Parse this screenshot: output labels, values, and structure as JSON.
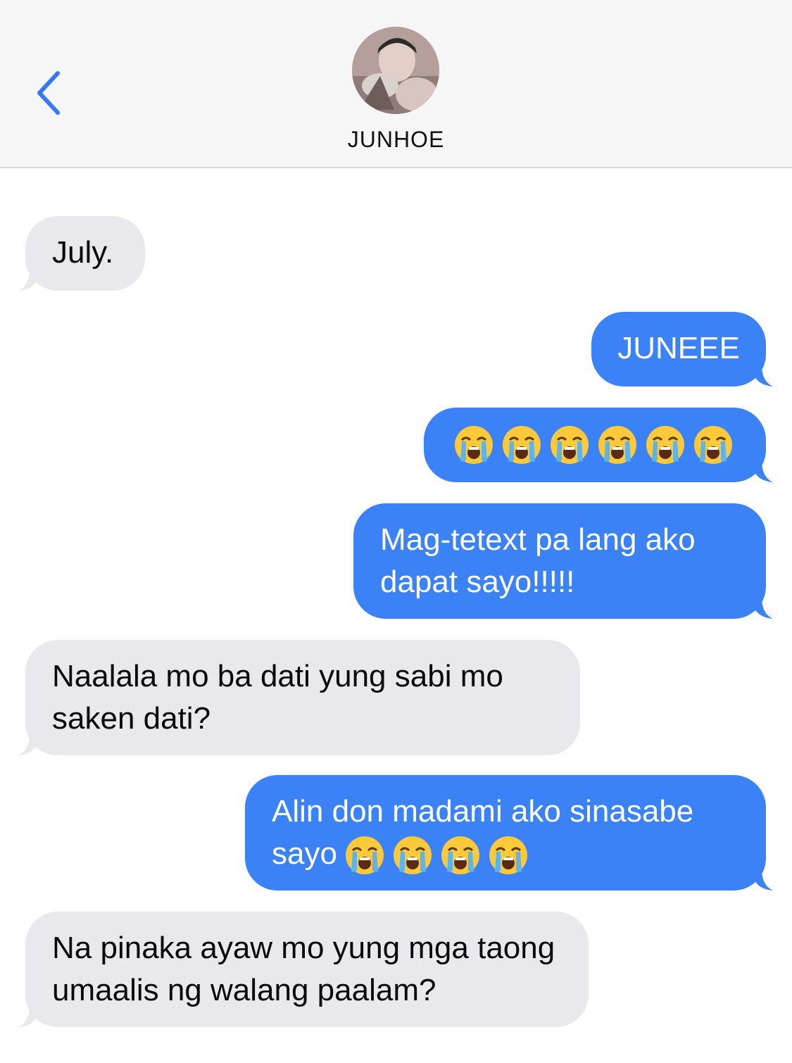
{
  "header": {
    "contact_name": "JUNHOE",
    "back_icon": "chevron-left-icon",
    "accent_color": "#3b82f6"
  },
  "messages": [
    {
      "direction": "incoming",
      "text": "July."
    },
    {
      "direction": "outgoing",
      "text": "JUNEEE"
    },
    {
      "direction": "outgoing",
      "text": "",
      "emoji": "loudly-crying-face",
      "emoji_count": 6
    },
    {
      "direction": "outgoing",
      "text": "Mag-tetext pa lang ako dapat sayo!!!!!"
    },
    {
      "direction": "incoming",
      "text": "Naalala mo ba dati yung sabi mo saken dati?"
    },
    {
      "direction": "outgoing",
      "text": "Alin don madami ako sinasabe sayo",
      "emoji": "loudly-crying-face",
      "emoji_count": 4
    },
    {
      "direction": "incoming",
      "text": "Na pinaka ayaw mo yung mga taong umaalis ng walang paalam?"
    }
  ]
}
